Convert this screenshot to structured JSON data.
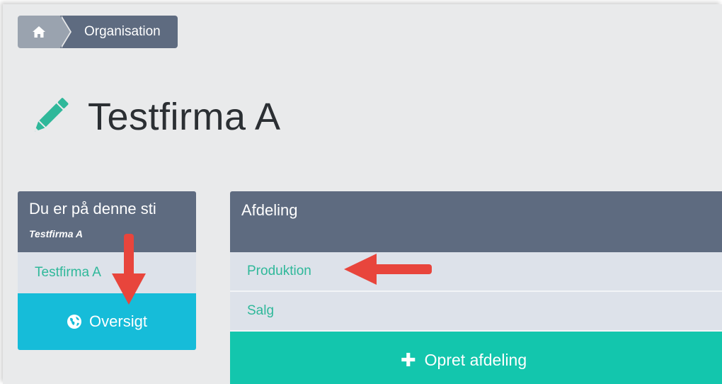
{
  "breadcrumb": {
    "home_icon": "home-icon",
    "current": "Organisation"
  },
  "page": {
    "title": "Testfirma A",
    "title_icon": "pencil-icon"
  },
  "path_panel": {
    "heading": "Du er på denne sti",
    "subheading": "Testfirma A",
    "items": [
      {
        "label": "Testfirma A"
      }
    ],
    "overview_button": {
      "icon": "globe-icon",
      "label": "Oversigt"
    }
  },
  "department_panel": {
    "heading": "Afdeling",
    "items": [
      {
        "label": "Produktion"
      },
      {
        "label": "Salg"
      }
    ],
    "create_button": {
      "icon": "plus-icon",
      "label": "Opret afdeling"
    }
  },
  "annotations": {
    "arrow_color": "#e8453c"
  },
  "colors": {
    "header": "#5e6b80",
    "link": "#2fb89a",
    "overview_button": "#16bcd9",
    "create_button": "#13c6ad"
  }
}
